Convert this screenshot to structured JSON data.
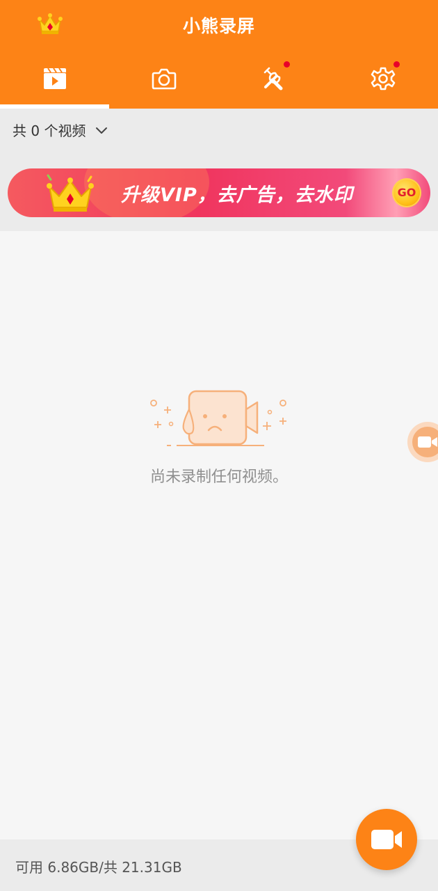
{
  "header": {
    "title": "小熊录屏",
    "crown_icon": "crown-icon",
    "tabs": [
      {
        "name": "videos",
        "icon": "video-clapper-icon",
        "active": true,
        "badge": false
      },
      {
        "name": "screenshots",
        "icon": "camera-icon",
        "active": false,
        "badge": false
      },
      {
        "name": "tools",
        "icon": "tools-icon",
        "active": false,
        "badge": true
      },
      {
        "name": "settings",
        "icon": "gear-icon",
        "active": false,
        "badge": true
      }
    ]
  },
  "list": {
    "count_label": "共 0 个视频"
  },
  "banner": {
    "text": "升级VIP，去广告，去水印",
    "go_label": "GO"
  },
  "empty_state": {
    "message": "尚未录制任何视频。"
  },
  "footer": {
    "storage": "可用 6.86GB/共 21.31GB"
  },
  "colors": {
    "primary": "#fd8316",
    "badge": "#e8002a",
    "banner": "#f0355e"
  }
}
